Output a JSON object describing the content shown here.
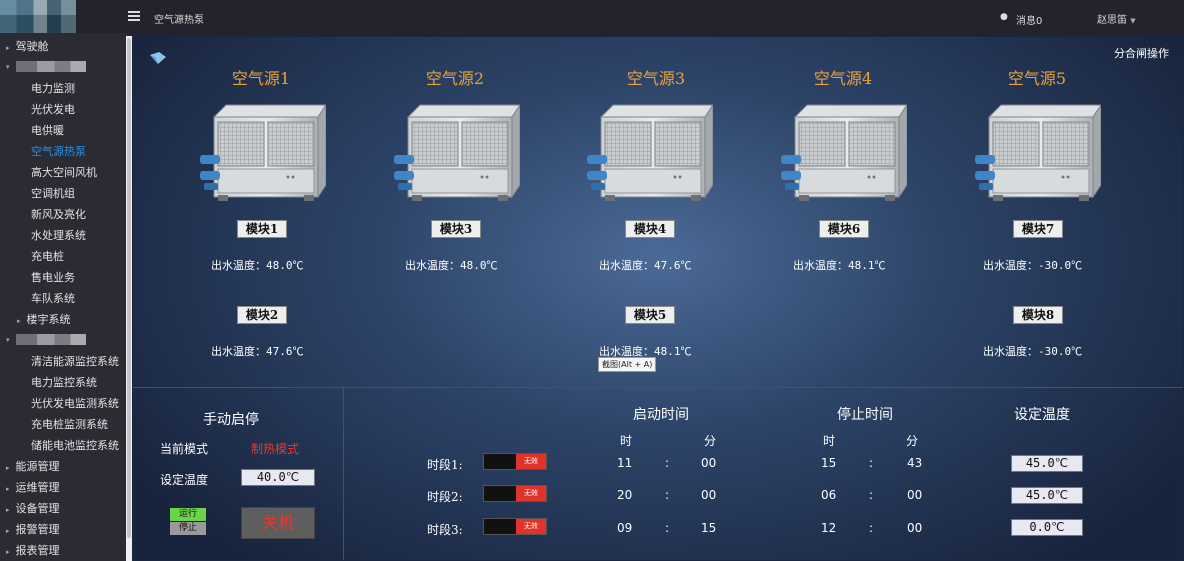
{
  "header": {
    "page_title": "空气源热泵",
    "messages": "消息0",
    "user_name": "赵思笛"
  },
  "sidebar": {
    "items": [
      {
        "label": "驾驶舱",
        "type": "group"
      },
      {
        "label": "",
        "type": "group-blurred"
      },
      {
        "label": "电力监测"
      },
      {
        "label": "光伏发电"
      },
      {
        "label": "电供暖"
      },
      {
        "label": "空气源热泵",
        "active": true
      },
      {
        "label": "高大空间风机"
      },
      {
        "label": "空调机组"
      },
      {
        "label": "新风及亮化"
      },
      {
        "label": "水处理系统"
      },
      {
        "label": "充电桩"
      },
      {
        "label": "售电业务"
      },
      {
        "label": "车队系统"
      },
      {
        "label": "楼宇系统",
        "type": "subgroup"
      },
      {
        "label": "",
        "type": "group-blurred"
      },
      {
        "label": "清洁能源监控系统"
      },
      {
        "label": "电力监控系统"
      },
      {
        "label": "光伏发电监测系统"
      },
      {
        "label": "充电桩监测系统"
      },
      {
        "label": "储能电池监控系统"
      },
      {
        "label": "能源管理",
        "type": "group"
      },
      {
        "label": "运维管理",
        "type": "group"
      },
      {
        "label": "设备管理",
        "type": "group"
      },
      {
        "label": "报警管理",
        "type": "group"
      },
      {
        "label": "报表管理",
        "type": "group"
      }
    ]
  },
  "main": {
    "switch_op": "分合闸操作",
    "units": [
      {
        "title": "空气源1",
        "modules": [
          {
            "name": "模块1",
            "temp": "出水温度：48.0℃"
          },
          {
            "name": "模块2",
            "temp": "出水温度：47.6℃"
          }
        ]
      },
      {
        "title": "空气源2",
        "modules": [
          {
            "name": "模块3",
            "temp": "出水温度：48.0℃"
          }
        ]
      },
      {
        "title": "空气源3",
        "modules": [
          {
            "name": "模块4",
            "temp": "出水温度：47.6℃"
          },
          {
            "name": "模块5",
            "temp": "出水温度：48.1℃"
          }
        ]
      },
      {
        "title": "空气源4",
        "modules": [
          {
            "name": "模块6",
            "temp": "出水温度：48.1℃"
          }
        ]
      },
      {
        "title": "空气源5",
        "modules": [
          {
            "name": "模块7",
            "temp": "出水温度：-30.0℃"
          },
          {
            "name": "模块8",
            "temp": "出水温度：-30.0℃"
          }
        ]
      }
    ],
    "tooltip": "截图(Alt + A)",
    "manual": {
      "title": "手动启停",
      "mode_label": "当前模式",
      "mode_value": "制热模式",
      "set_label": "设定温度",
      "set_value": "40.0℃",
      "run": "运行",
      "stop": "停止",
      "power": "关机"
    },
    "schedule": {
      "start_header": "启动时间",
      "stop_header": "停止时间",
      "temp_header": "设定温度",
      "hour": "时",
      "minute": "分",
      "colon": ":",
      "rows": [
        {
          "label": "时段1:",
          "switch": "无效",
          "start_h": "11",
          "start_m": "00",
          "stop_h": "15",
          "stop_m": "43",
          "temp": "45.0℃"
        },
        {
          "label": "时段2:",
          "switch": "无效",
          "start_h": "20",
          "start_m": "00",
          "stop_h": "06",
          "stop_m": "00",
          "temp": "45.0℃"
        },
        {
          "label": "时段3:",
          "switch": "无效",
          "start_h": "09",
          "start_m": "15",
          "stop_h": "12",
          "stop_m": "00",
          "temp": "0.0℃"
        }
      ]
    }
  }
}
